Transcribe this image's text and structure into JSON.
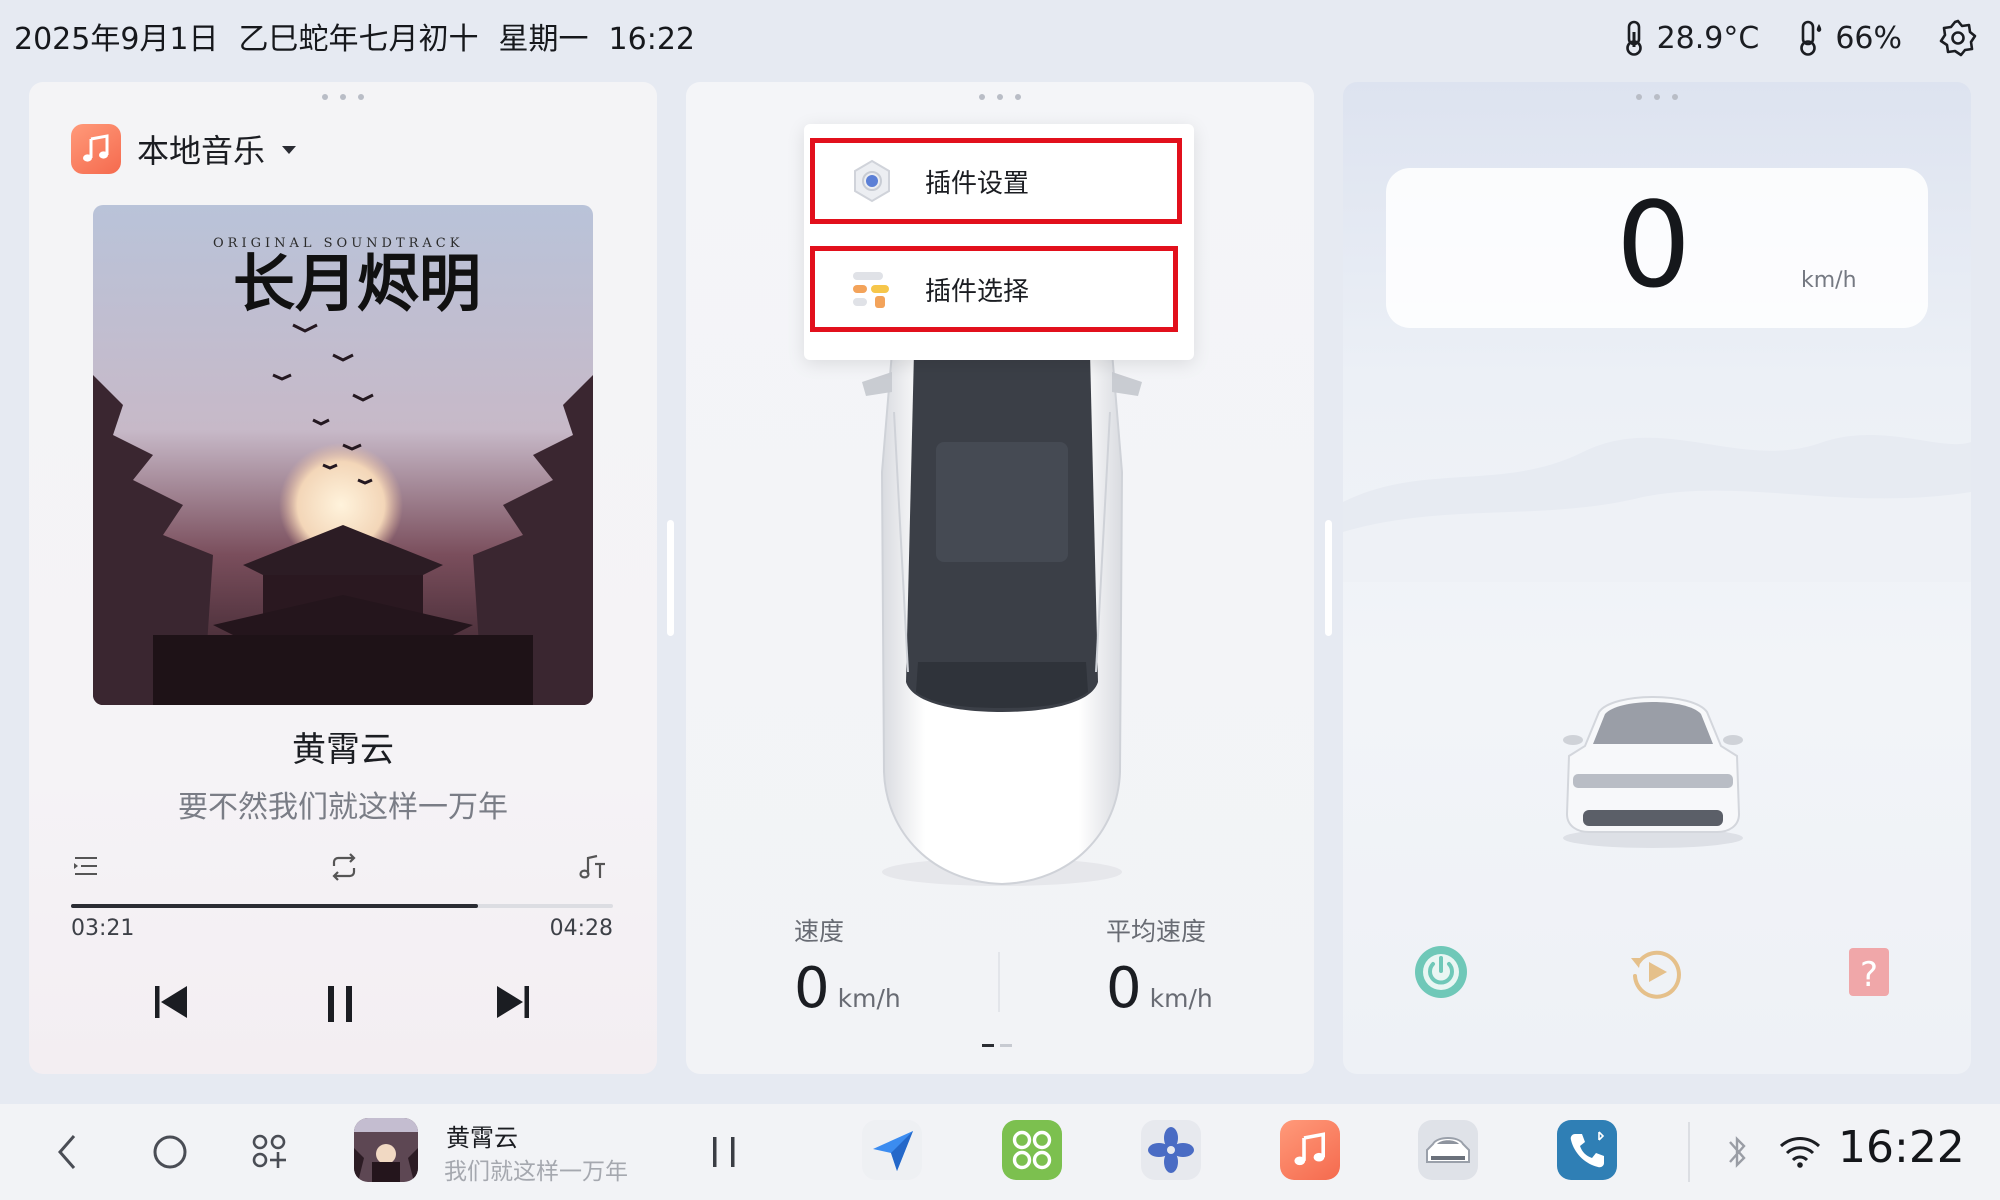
{
  "status_bar": {
    "date": "2025年9月1日",
    "lunar": "乙巳蛇年七月初十",
    "weekday": "星期一",
    "time": "16:22",
    "temperature": "28.9°C",
    "humidity": "66%",
    "icons": [
      "thermometer-icon",
      "humidity-icon",
      "settings-gear-icon"
    ]
  },
  "music": {
    "source_label": "本地音乐",
    "album": {
      "header_line": "ORIGINAL SOUNDTRACK",
      "title_art": "长月烬明"
    },
    "artist": "黄霄云",
    "lyric": "要不然我们就这样一万年",
    "current_time": "03:21",
    "total_time": "04:28",
    "progress": 0.75
  },
  "car_panel": {
    "popup": {
      "items": [
        {
          "label": "插件设置",
          "icon": "plugin-settings-icon"
        },
        {
          "label": "插件选择",
          "icon": "plugin-select-icon"
        }
      ]
    },
    "speed": {
      "label": "速度",
      "value": "0",
      "unit": "km/h"
    },
    "avg_speed": {
      "label": "平均速度",
      "value": "0",
      "unit": "km/h"
    },
    "page_index": 1,
    "page_count": 2
  },
  "speed_panel": {
    "value": "0",
    "unit": "km/h",
    "actions": [
      "power-icon",
      "replay-icon",
      "help-icon"
    ]
  },
  "dock": {
    "now_playing_title": "黄霄云",
    "now_playing_subtitle": "我们就这样一万年",
    "apps": [
      "navigation-app",
      "apps-grid-app",
      "fan-app",
      "music-app",
      "vehicle-app",
      "phone-app"
    ],
    "clock": "16:22"
  },
  "colors": {
    "highlight": "#e2101c",
    "music_accent": "#f56a4e",
    "power_green": "#6fc8b8",
    "replay_tan": "#e5c08a",
    "help_pink": "#f0a7a9"
  }
}
